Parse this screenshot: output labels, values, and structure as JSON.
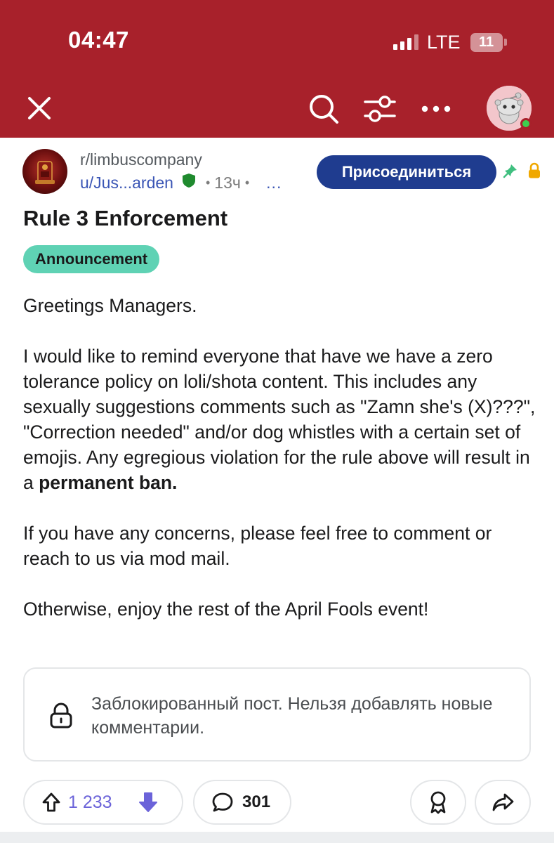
{
  "status_bar": {
    "time": "04:47",
    "network": "LTE",
    "battery": "11"
  },
  "toolbar": {
    "close_icon": "close-icon",
    "search_icon": "search-icon",
    "filter_icon": "filter-icon",
    "more_icon": "more-icon",
    "avatar_icon": "snoo-avatar-icon"
  },
  "post": {
    "subreddit": "r/limbuscompany",
    "author": "u/Jus...arden",
    "moderator_icon": "shield-icon",
    "separator": "•",
    "age": "13ч",
    "more": "...",
    "join_label": "Присоединиться",
    "pinned_icon": "pin-icon",
    "locked_icon": "lock-icon",
    "title": "Rule 3 Enforcement",
    "flair": "Announcement",
    "body": {
      "greeting": "Greetings Managers.",
      "paragraph1": "I would like to remind everyone that have we have a zero tolerance policy on loli/shota content. This includes any sexually suggestions comments such as \"Zamn she's (X)???\", \"Correction needed\" and/or dog whistles with a certain set of emojis. Any egregious violation for the rule above will result in a ",
      "paragraph1_bold": "permanent ban.",
      "paragraph2": "If you have any concerns, please feel free to comment or reach to us via mod mail.",
      "paragraph3": "Otherwise, enjoy the rest of the April Fools event!"
    },
    "locked_notice": "Заблокированный пост. Нельзя добавлять новые комментарии."
  },
  "actions": {
    "upvote_count": "1 233",
    "comment_count": "301",
    "colors": {
      "header": "#a8212b",
      "join_button": "#1f3c8f",
      "flair": "#5fd2b4",
      "vote_active": "#6b63d9",
      "online": "#3ccf4e"
    }
  }
}
